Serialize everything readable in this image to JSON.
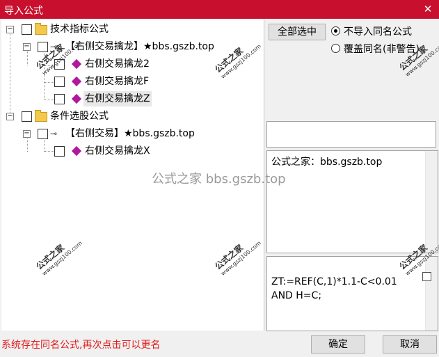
{
  "window": {
    "title": "导入公式",
    "close_glyph": "✕"
  },
  "tree": {
    "group1": {
      "label": "技术指标公式"
    },
    "group1_child": {
      "label": "【右侧交易擒龙】★bbs.gszb.top"
    },
    "group1_leaves": [
      "右侧交易擒龙2",
      "右侧交易擒龙F",
      "右侧交易擒龙Z"
    ],
    "group2": {
      "label": "条件选股公式"
    },
    "group2_child": {
      "label": "【右侧交易】★bbs.gszb.top"
    },
    "group2_leaves": [
      "右侧交易擒龙X"
    ]
  },
  "controls": {
    "select_all_label": "全部选中",
    "radio_no_import": "不导入同名公式",
    "radio_overwrite": "覆盖同名(非警告)",
    "selected_radio": "no_import"
  },
  "info_panel": {
    "text": "公式之家：bbs.gszb.top"
  },
  "code_panel": {
    "text": "ZT:=REF(C,1)*1.1-C<0.01\nAND H=C;"
  },
  "status": {
    "message": "系统存在同名公式,再次点击可以更名"
  },
  "buttons": {
    "ok": "确定",
    "cancel": "取消"
  },
  "watermark": {
    "text": "公式之家",
    "url": "www.gszj100.com",
    "center_text": "公式之家 bbs.gszb.top"
  },
  "colors": {
    "titlebar": "#c8102e",
    "status_text": "#e21b1b"
  }
}
